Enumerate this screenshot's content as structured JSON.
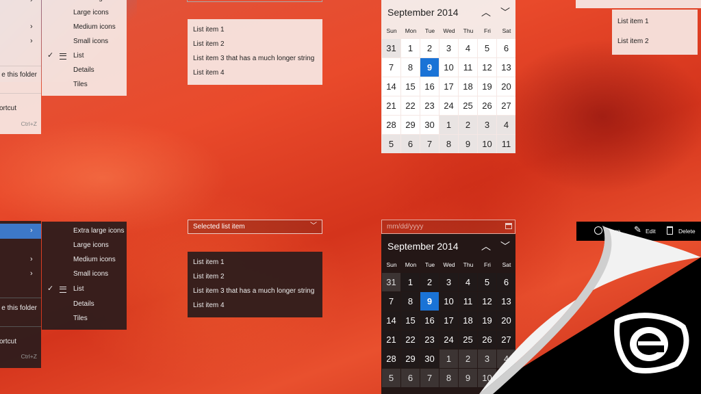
{
  "top_left_menu": {
    "outer_items": [
      {
        "label": "",
        "chevron": true
      },
      {
        "label": "",
        "chevron": true
      },
      {
        "label": "",
        "chevron": true
      },
      {
        "label": "e this folder",
        "chevron": false
      },
      {
        "label": "ortcut",
        "chevron": false
      },
      {
        "label": "Ctrl+Z",
        "chevron": false
      }
    ],
    "view_items": [
      "Extra large icons",
      "Large icons",
      "Medium icons",
      "Small icons",
      "List",
      "Details",
      "Tiles"
    ]
  },
  "bottom_left_menu": {
    "outer_items": [
      "e this folder",
      "ortcut",
      "Ctrl+Z"
    ],
    "view_items": [
      "Extra large icons",
      "Large icons",
      "Medium icons",
      "Small icons",
      "List",
      "Details",
      "Tiles"
    ]
  },
  "list_light": [
    "List item 1",
    "List item 2",
    "List item 3 that has a much longer string",
    "List item 4"
  ],
  "combo_dark": {
    "selected": "Selected list item"
  },
  "list_dark": [
    "List item 1",
    "List item 2",
    "List item 3 that has a much longer string",
    "List item 4"
  ],
  "calendar_light": {
    "title": "September 2014",
    "dow": [
      "Sun",
      "Mon",
      "Tue",
      "Wed",
      "Thu",
      "Fri",
      "Sat"
    ],
    "weeks": [
      [
        "31",
        "1",
        "2",
        "3",
        "4",
        "5",
        "6"
      ],
      [
        "7",
        "8",
        "9",
        "10",
        "11",
        "12",
        "13"
      ],
      [
        "14",
        "15",
        "16",
        "17",
        "18",
        "19",
        "20"
      ],
      [
        "21",
        "22",
        "23",
        "24",
        "25",
        "26",
        "27"
      ],
      [
        "28",
        "29",
        "30",
        "1",
        "2",
        "3",
        "4"
      ],
      [
        "5",
        "6",
        "7",
        "8",
        "9",
        "10",
        "11"
      ]
    ],
    "selected": "9"
  },
  "date_picker": {
    "placeholder": "mm/dd/yyyy"
  },
  "calendar_dark": {
    "title": "September 2014",
    "dow": [
      "Sun",
      "Mon",
      "Tue",
      "Wed",
      "Thu",
      "Fri",
      "Sat"
    ],
    "weeks": [
      [
        "31",
        "1",
        "2",
        "3",
        "4",
        "5",
        "6"
      ],
      [
        "7",
        "8",
        "9",
        "10",
        "11",
        "12",
        "13"
      ],
      [
        "14",
        "15",
        "16",
        "17",
        "18",
        "19",
        "20"
      ],
      [
        "21",
        "22",
        "23",
        "24",
        "25",
        "26",
        "27"
      ],
      [
        "28",
        "29",
        "30",
        "1",
        "2",
        "3",
        "4"
      ],
      [
        "5",
        "6",
        "7",
        "8",
        "9",
        "10"
      ]
    ],
    "selected": "9"
  },
  "right_list_light": [
    "List item 1",
    "List item 2"
  ],
  "command_bar": {
    "share": "are",
    "edit": "Edit",
    "delete": "Delete"
  },
  "colors": {
    "accent": "#1a73d6"
  }
}
